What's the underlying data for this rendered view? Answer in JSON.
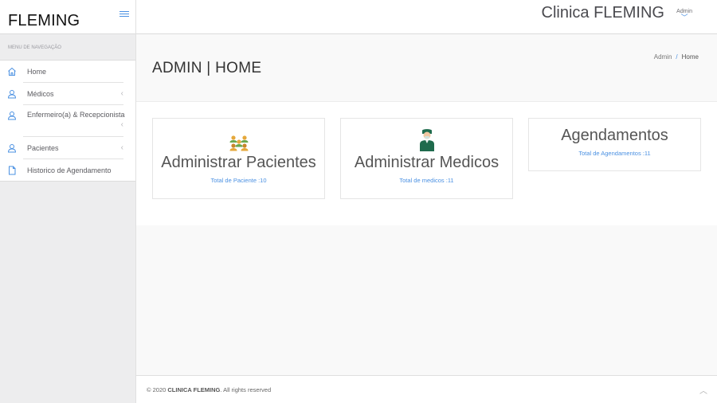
{
  "brand": {
    "name": "FLEMING"
  },
  "topbar": {
    "title": "Clinica FLEMING",
    "user": "Admin"
  },
  "nav": {
    "heading": "MENU DE NAVEGAÇÃO",
    "items": [
      {
        "label": "Home",
        "icon": "home-icon",
        "has_submenu": false
      },
      {
        "label": "Médicos",
        "icon": "user-icon",
        "has_submenu": true
      },
      {
        "label": "Enfermeiro(a) & Recepcionista",
        "icon": "user-icon",
        "has_submenu": true
      },
      {
        "label": "Pacientes",
        "icon": "user-icon",
        "has_submenu": true
      },
      {
        "label": "Historico de Agendamento",
        "icon": "file-icon",
        "has_submenu": false
      }
    ]
  },
  "page": {
    "title": "ADMIN | HOME",
    "breadcrumb": {
      "root": "Admin",
      "sep": "/",
      "current": "Home"
    }
  },
  "cards": [
    {
      "title": "Administrar Pacientes",
      "link": "Total de Paciente :10",
      "icon": "patients-group-icon"
    },
    {
      "title": "Administrar Medicos",
      "link": "Total de medicos :11",
      "icon": "doctor-icon"
    },
    {
      "title": "Agendamentos",
      "link": "Total de Agendamentos :11",
      "icon": ""
    }
  ],
  "footer": {
    "prefix": "© 2020",
    "brand": "CLINICA FLEMING",
    "suffix": ". All rights reserved"
  },
  "colors": {
    "accent": "#4a90e2",
    "sidebar": "#ededee"
  }
}
